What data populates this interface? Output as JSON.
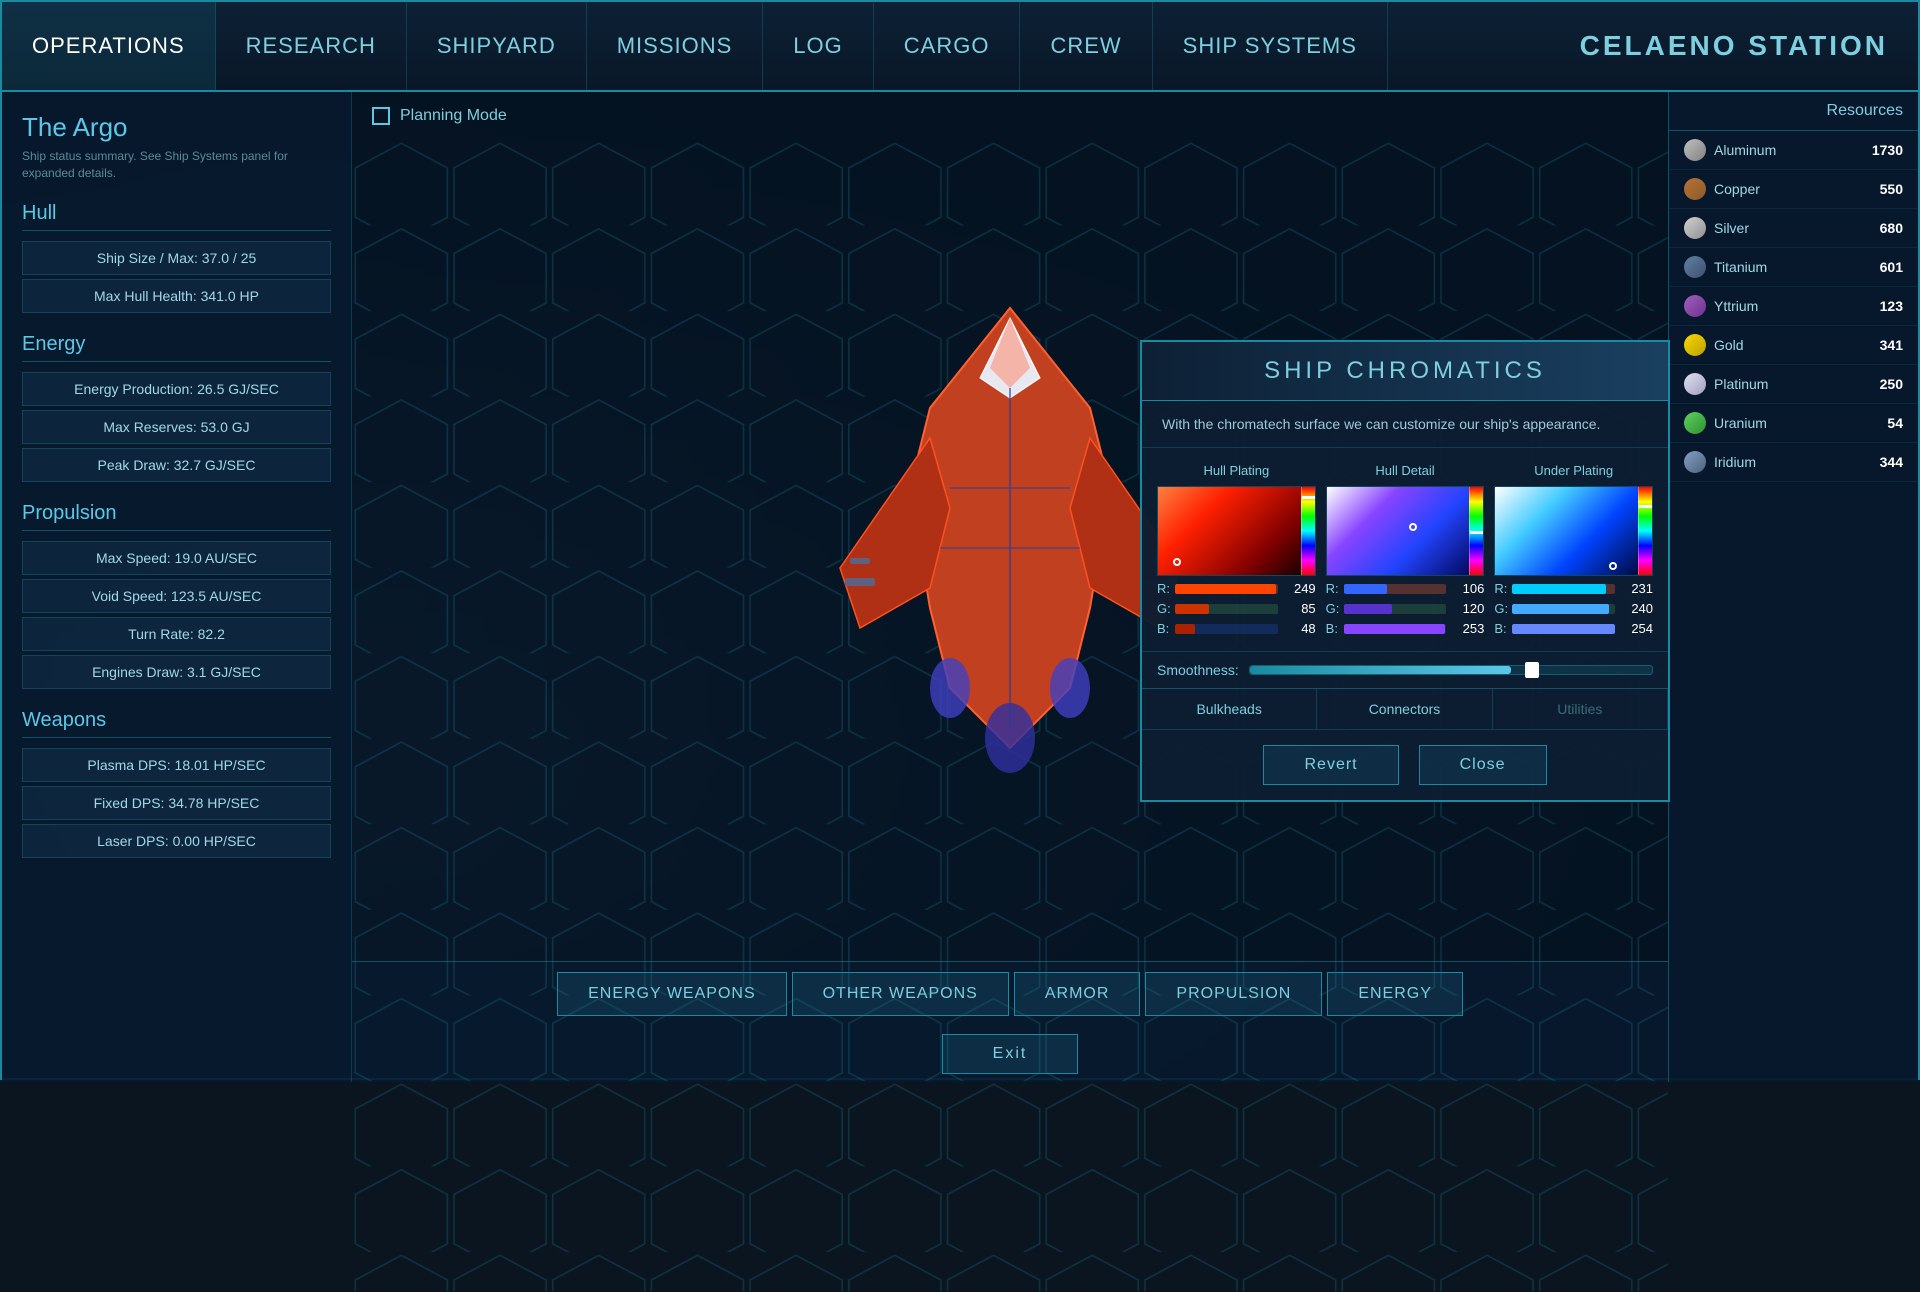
{
  "station": {
    "title": "CELAENO STATION"
  },
  "nav": {
    "items": [
      {
        "label": "Operations",
        "active": true
      },
      {
        "label": "Research",
        "active": false
      },
      {
        "label": "Shipyard",
        "active": false
      },
      {
        "label": "Missions",
        "active": false
      },
      {
        "label": "Log",
        "active": false
      },
      {
        "label": "Cargo",
        "active": false
      },
      {
        "label": "Crew",
        "active": false
      },
      {
        "label": "Ship Systems",
        "active": false
      }
    ]
  },
  "ship": {
    "name": "The Argo",
    "subtitle": "Ship status summary. See Ship Systems panel for expanded details.",
    "planning_mode_label": "Planning Mode"
  },
  "hull": {
    "header": "Hull",
    "stats": [
      {
        "label": "Ship Size / Max: 37.0 / 25"
      },
      {
        "label": "Max Hull Health: 341.0 HP"
      }
    ]
  },
  "energy": {
    "header": "Energy",
    "stats": [
      {
        "label": "Energy Production: 26.5 GJ/SEC"
      },
      {
        "label": "Max Reserves: 53.0 GJ"
      },
      {
        "label": "Peak Draw: 32.7 GJ/SEC"
      }
    ]
  },
  "propulsion": {
    "header": "Propulsion",
    "stats": [
      {
        "label": "Max Speed: 19.0 AU/SEC"
      },
      {
        "label": "Void Speed: 123.5 AU/SEC"
      },
      {
        "label": "Turn Rate: 82.2"
      },
      {
        "label": "Engines Draw: 3.1 GJ/SEC"
      }
    ]
  },
  "weapons": {
    "header": "Weapons",
    "stats": [
      {
        "label": "Plasma DPS: 18.01 HP/SEC"
      },
      {
        "label": "Fixed DPS: 34.78 HP/SEC"
      },
      {
        "label": "Laser DPS: 0.00 HP/SEC"
      }
    ]
  },
  "bottom_tabs": [
    {
      "label": "Energy Weapons",
      "active": false
    },
    {
      "label": "Other Weapons",
      "active": false
    },
    {
      "label": "Armor",
      "active": false
    },
    {
      "label": "Propulsion",
      "active": false
    },
    {
      "label": "Energy",
      "active": false
    }
  ],
  "exit_label": "Exit",
  "resources": {
    "header": "Resources",
    "items": [
      {
        "name": "Aluminum",
        "value": "1730",
        "icon_class": "icon-aluminum"
      },
      {
        "name": "Copper",
        "value": "550",
        "icon_class": "icon-copper"
      },
      {
        "name": "Silver",
        "value": "680",
        "icon_class": "icon-silver"
      },
      {
        "name": "Titanium",
        "value": "601",
        "icon_class": "icon-titanium"
      },
      {
        "name": "Yttrium",
        "value": "123",
        "icon_class": "icon-yttrium"
      },
      {
        "name": "Gold",
        "value": "341",
        "icon_class": "icon-gold"
      },
      {
        "name": "Platinum",
        "value": "250",
        "icon_class": "icon-platinum"
      },
      {
        "name": "Uranium",
        "value": "54",
        "icon_class": "icon-uranium"
      },
      {
        "name": "Iridium",
        "value": "344",
        "icon_class": "icon-iridium"
      }
    ]
  },
  "chromatics": {
    "title": "SHIP  CHROMATICS",
    "description": "With the chromatech surface we can customize our ship's appearance.",
    "sections": [
      {
        "label": "Hull Plating",
        "dot_x": "12%",
        "dot_y": "85%",
        "slider_pos": "10%",
        "r_value": "249",
        "g_value": "85",
        "b_value": "48",
        "r_color": "#ff4400",
        "g_color": "#cc3300",
        "b_color": "#aa2200"
      },
      {
        "label": "Hull Detail",
        "dot_x": "55%",
        "dot_y": "45%",
        "slider_pos": "50%",
        "r_value": "106",
        "g_value": "120",
        "b_value": "253",
        "r_color": "#3366ff",
        "g_color": "#5533cc",
        "b_color": "#8844ff"
      },
      {
        "label": "Under Plating",
        "dot_x": "75%",
        "dot_y": "90%",
        "slider_pos": "20%",
        "r_value": "231",
        "g_value": "240",
        "b_value": "254",
        "r_color": "#00ccff",
        "g_color": "#44aaff",
        "b_color": "#6688ff"
      }
    ],
    "smoothness_label": "Smoothness:",
    "smoothness_pct": 65,
    "bottom_tabs": [
      {
        "label": "Bulkheads"
      },
      {
        "label": "Connectors"
      },
      {
        "label": "Utilities",
        "faded": true
      }
    ],
    "revert_label": "Revert",
    "close_label": "Close"
  }
}
